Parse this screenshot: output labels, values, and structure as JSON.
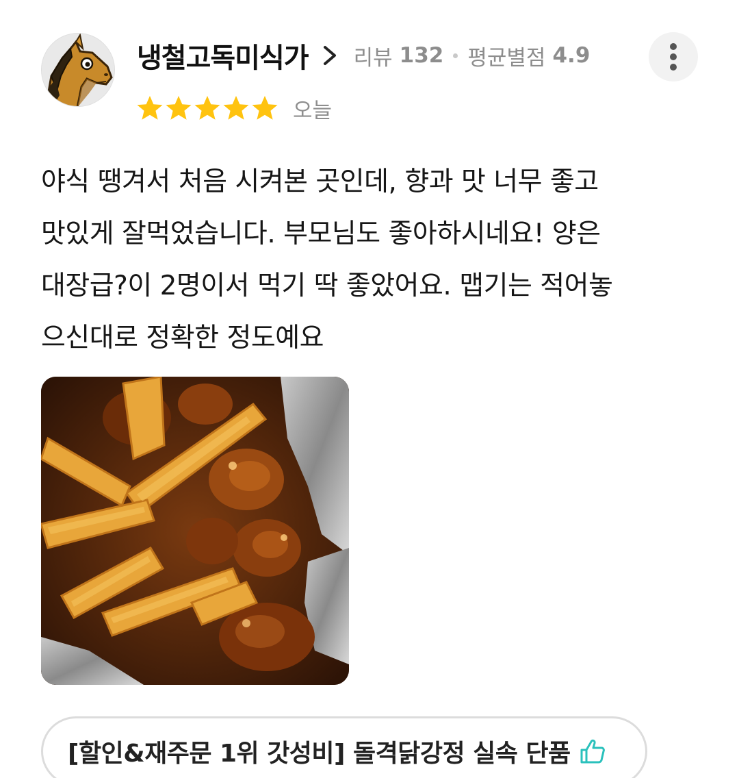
{
  "reviewer": {
    "nickname": "냉철고독미식가",
    "review_label": "리뷰",
    "review_count": "132",
    "avg_label": "평균별점",
    "avg_rating": "4.9",
    "avatar": "horse-mask-icon"
  },
  "review": {
    "stars": 5,
    "date": "오늘",
    "lines": [
      "야식 땡겨서 처음 시켜본 곳인데, 향과 맛 너무 좋고",
      " 맛있게 잘먹었습니다. 부모님도 좋아하시네요! 양은",
      "대장급?이 2명이서 먹기 딱 좋았어요. 맵기는 적어놓",
      "으신대로 정확한 정도예요"
    ]
  },
  "menu": {
    "label": "[할인&재주문 1위 갓성비] 돌격닭강정 실속 단품",
    "icon": "thumbs-up-icon"
  },
  "colors": {
    "star": "#FFC30F",
    "accent_teal": "#2AC1BC",
    "muted_text": "#8D8D8D"
  }
}
